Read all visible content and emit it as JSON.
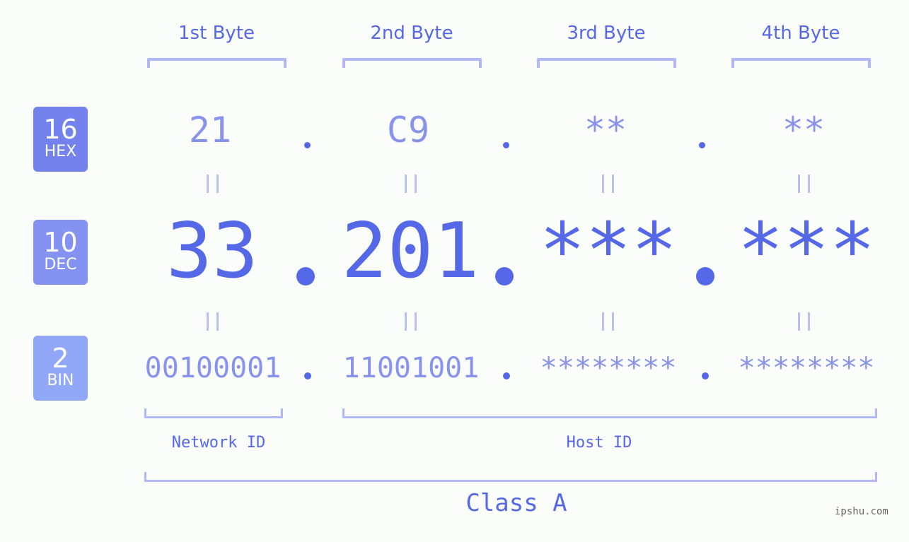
{
  "byte_headers": [
    "1st Byte",
    "2nd Byte",
    "3rd Byte",
    "4th Byte"
  ],
  "badges": {
    "hex": {
      "base": "16",
      "label": "HEX",
      "color": "#7382ec"
    },
    "dec": {
      "base": "10",
      "label": "DEC",
      "color": "#8493f1"
    },
    "bin": {
      "base": "2",
      "label": "BIN",
      "color": "#91a8f8"
    }
  },
  "hex_values": [
    "21",
    "C9",
    "**",
    "**"
  ],
  "dec_values": [
    "33",
    "201",
    "***",
    "***"
  ],
  "bin_values": [
    "00100001",
    "11001001",
    "********",
    "********"
  ],
  "separator": ".",
  "network_id_label": "Network ID",
  "host_id_label": "Host ID",
  "class_label": "Class A",
  "watermark": "ipshu.com",
  "colors": {
    "accent": "#5468e8",
    "light_accent": "#8793ec",
    "bracket": "#b0b9f6",
    "background": "#fbfdfb"
  }
}
